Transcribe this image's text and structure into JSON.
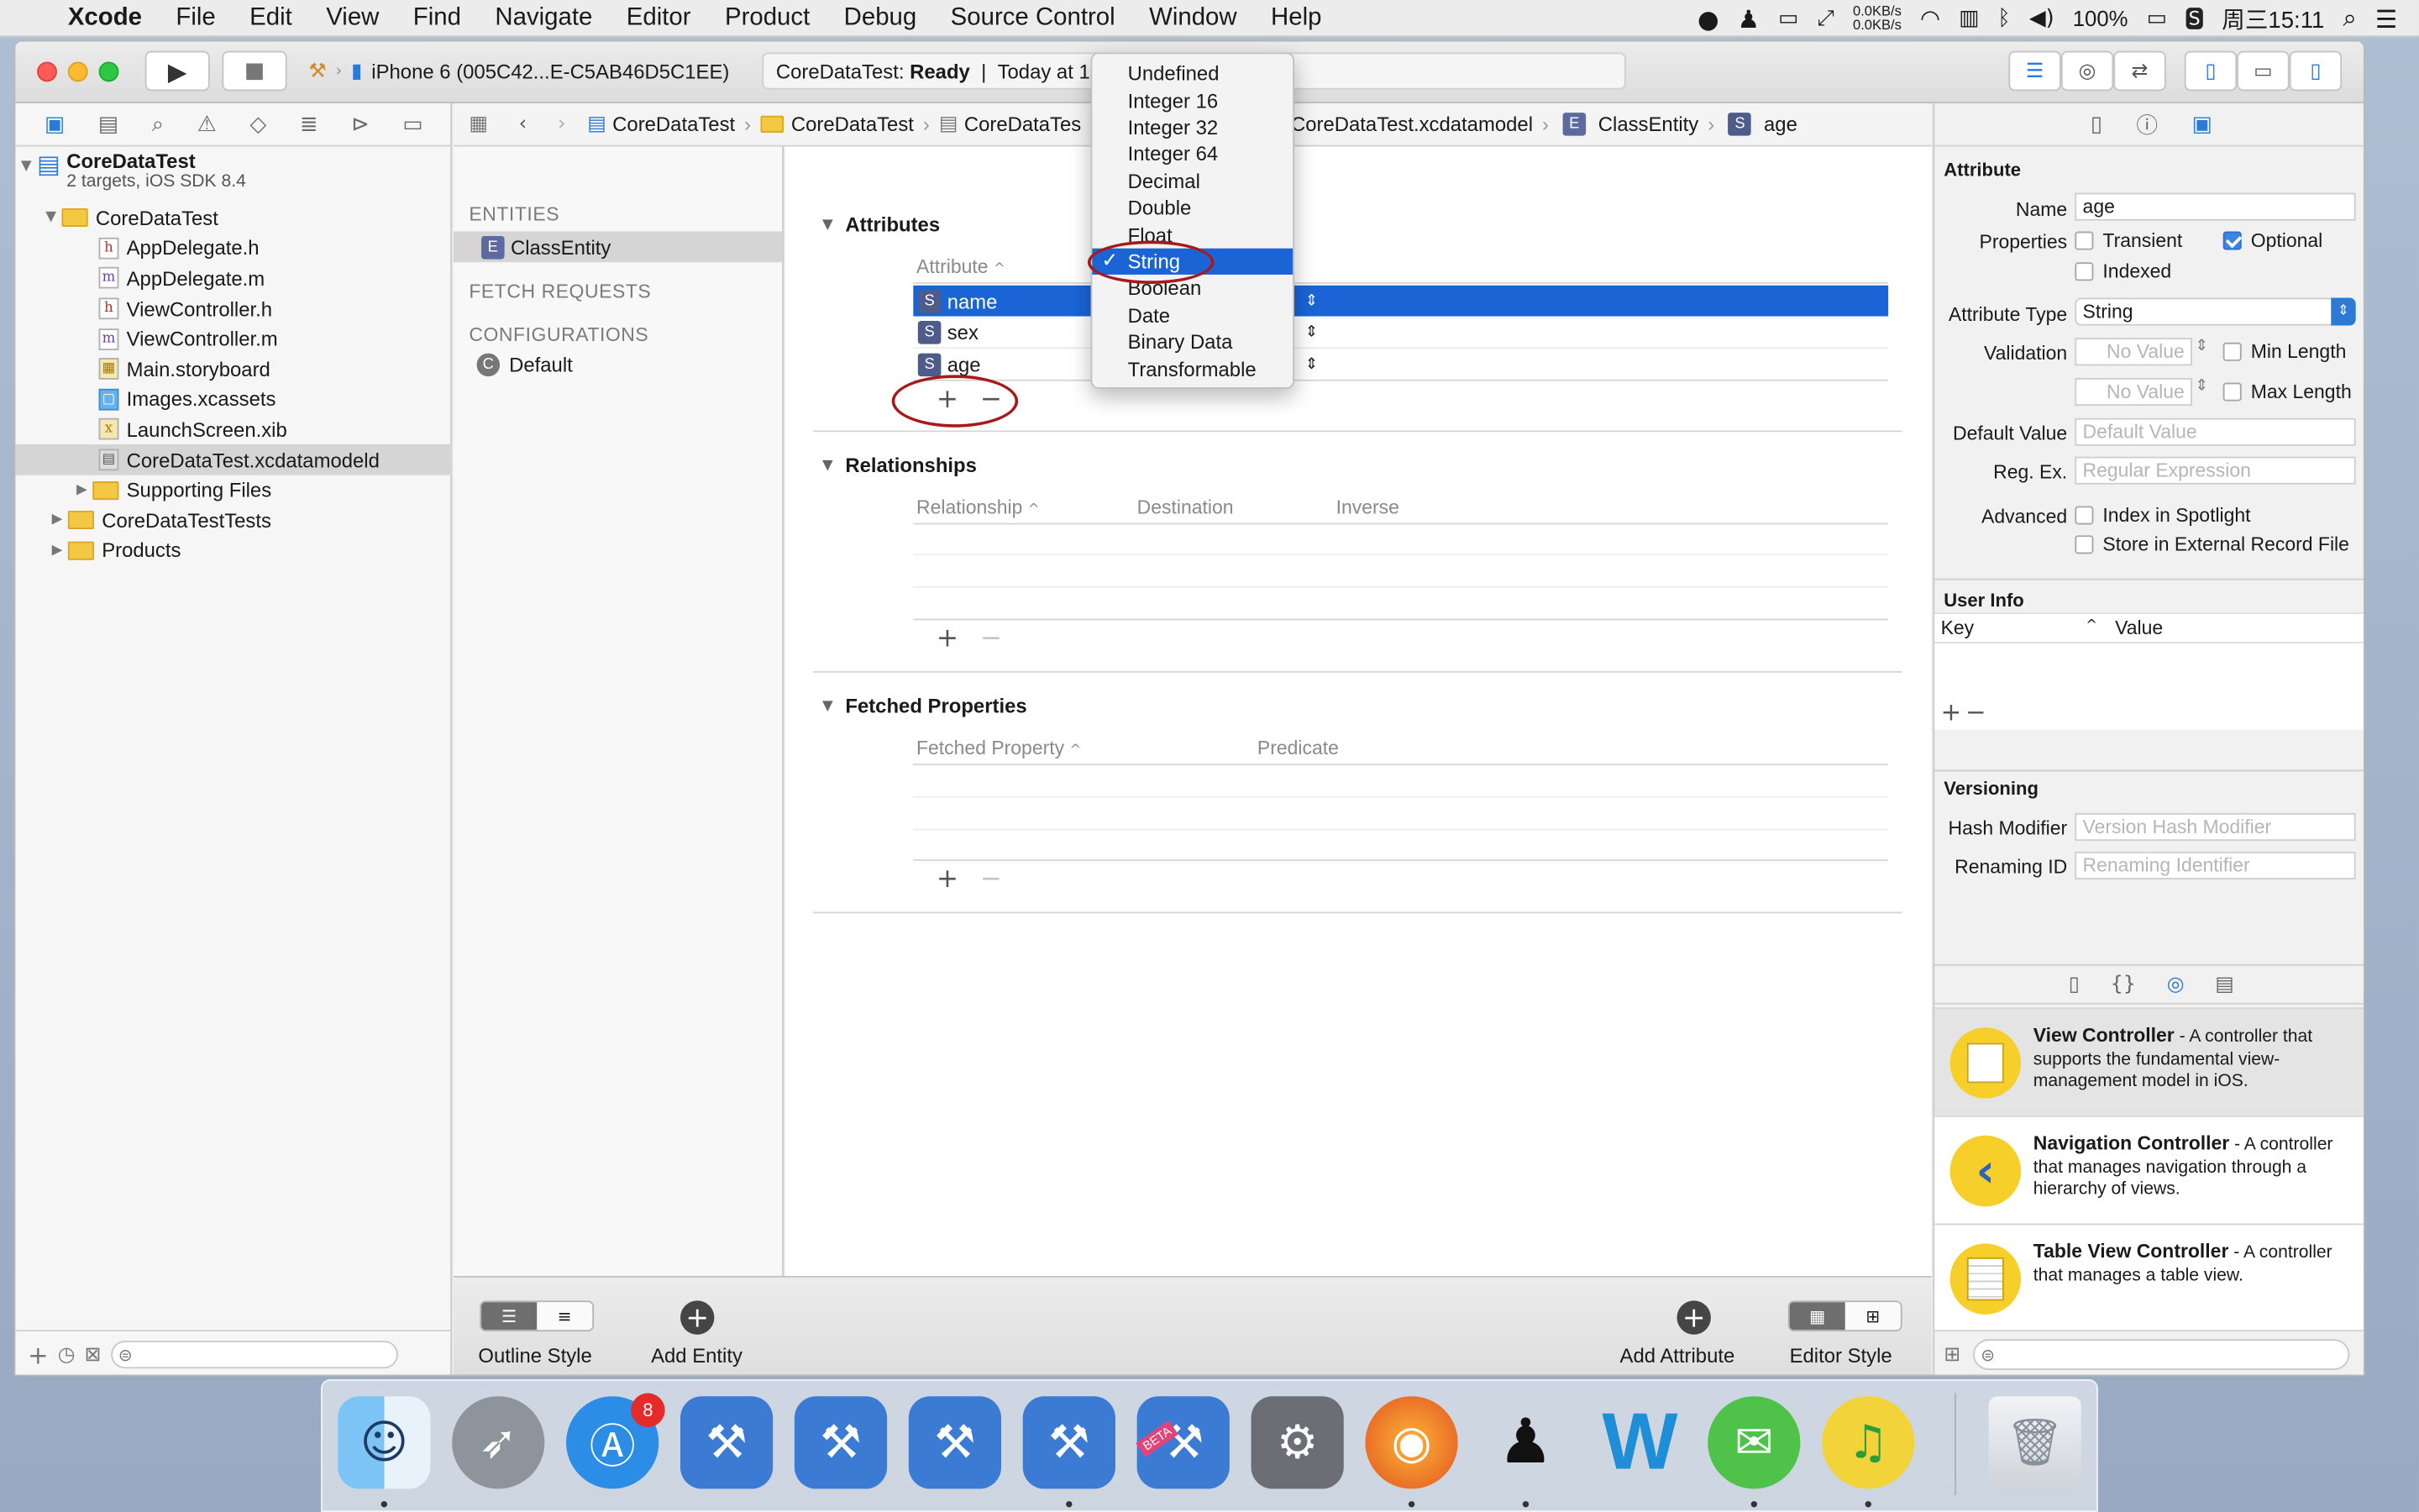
{
  "menubar": {
    "app": "Xcode",
    "items": [
      "File",
      "Edit",
      "View",
      "Find",
      "Navigate",
      "Editor",
      "Product",
      "Debug",
      "Source Control",
      "Window",
      "Help"
    ],
    "net_up": "0.0KB/s",
    "net_down": "0.0KB/s",
    "battery": "100%",
    "clock": "周三15:11"
  },
  "toolbar": {
    "scheme_device": "iPhone 6 (005C42...E-C5AB46D5C1EE)",
    "status_project": "CoreDataTest:",
    "status_state": "Ready",
    "status_time": "Today at 1",
    "colors": {
      "close": "#fd5b56",
      "minimize": "#fcbb2f",
      "zoom": "#2dc842"
    }
  },
  "navigator": {
    "project": {
      "name": "CoreDataTest",
      "subtitle": "2 targets, iOS SDK 8.4"
    },
    "group": "CoreDataTest",
    "files": [
      {
        "name": "AppDelegate.h",
        "kind": "h"
      },
      {
        "name": "AppDelegate.m",
        "kind": "m"
      },
      {
        "name": "ViewController.h",
        "kind": "h"
      },
      {
        "name": "ViewController.m",
        "kind": "m"
      },
      {
        "name": "Main.storyboard",
        "kind": "storyboard"
      },
      {
        "name": "Images.xcassets",
        "kind": "assets"
      },
      {
        "name": "LaunchScreen.xib",
        "kind": "xib"
      },
      {
        "name": "CoreDataTest.xcdatamodeld",
        "kind": "model",
        "selected": true
      },
      {
        "name": "Supporting Files",
        "kind": "folder"
      }
    ],
    "top_groups": [
      "CoreDataTestTests",
      "Products"
    ]
  },
  "jumpbar": {
    "crumbs": [
      "CoreDataTest",
      "CoreDataTest",
      "CoreDataTes",
      "CoreDataTest.xcdatamodel",
      "ClassEntity",
      "age"
    ]
  },
  "outline": {
    "entities_header": "ENTITIES",
    "entity": "ClassEntity",
    "fetch_header": "FETCH REQUESTS",
    "config_header": "CONFIGURATIONS",
    "config": "Default"
  },
  "editor": {
    "attributes_title": "Attributes",
    "attribute_col": "Attribute",
    "attributes": [
      {
        "badge": "S",
        "name": "name",
        "selected": true
      },
      {
        "badge": "S",
        "name": "sex",
        "selected": false
      },
      {
        "badge": "S",
        "name": "age",
        "selected": false
      }
    ],
    "relationships_title": "Relationships",
    "rel_cols": [
      "Relationship",
      "Destination",
      "Inverse"
    ],
    "fetched_title": "Fetched Properties",
    "fetched_cols": [
      "Fetched Property",
      "Predicate"
    ]
  },
  "type_popup": {
    "items": [
      "Undefined",
      "Integer 16",
      "Integer 32",
      "Integer 64",
      "Decimal",
      "Double",
      "Float",
      "String",
      "Boolean",
      "Date",
      "Binary Data",
      "Transformable"
    ],
    "selected": "String"
  },
  "bottombar": {
    "outline_style": "Outline Style",
    "add_entity": "Add Entity",
    "add_attribute": "Add Attribute",
    "editor_style": "Editor Style"
  },
  "inspector": {
    "section": "Attribute",
    "name_label": "Name",
    "name_value": "age",
    "properties_label": "Properties",
    "transient": "Transient",
    "optional": "Optional",
    "indexed": "Indexed",
    "type_label": "Attribute Type",
    "type_value": "String",
    "validation_label": "Validation",
    "no_value": "No Value",
    "min_length": "Min Length",
    "max_length": "Max Length",
    "default_label": "Default Value",
    "default_ph": "Default Value",
    "regex_label": "Reg. Ex.",
    "regex_ph": "Regular Expression",
    "advanced_label": "Advanced",
    "spotlight": "Index in Spotlight",
    "external": "Store in External Record File",
    "userinfo_title": "User Info",
    "key_col": "Key",
    "value_col": "Value",
    "versioning_title": "Versioning",
    "hash_label": "Hash Modifier",
    "hash_ph": "Version Hash Modifier",
    "renaming_label": "Renaming ID",
    "renaming_ph": "Renaming Identifier",
    "library": [
      {
        "title": "View Controller",
        "desc": " - A controller that supports the fundamental view-management model in iOS."
      },
      {
        "title": "Navigation Controller",
        "desc": " - A controller that manages navigation through a hierarchy of views."
      },
      {
        "title": "Table View Controller",
        "desc": " - A controller that manages a table view."
      }
    ]
  },
  "dock": {
    "appstore_badge": "8",
    "beta_label": "BETA"
  }
}
